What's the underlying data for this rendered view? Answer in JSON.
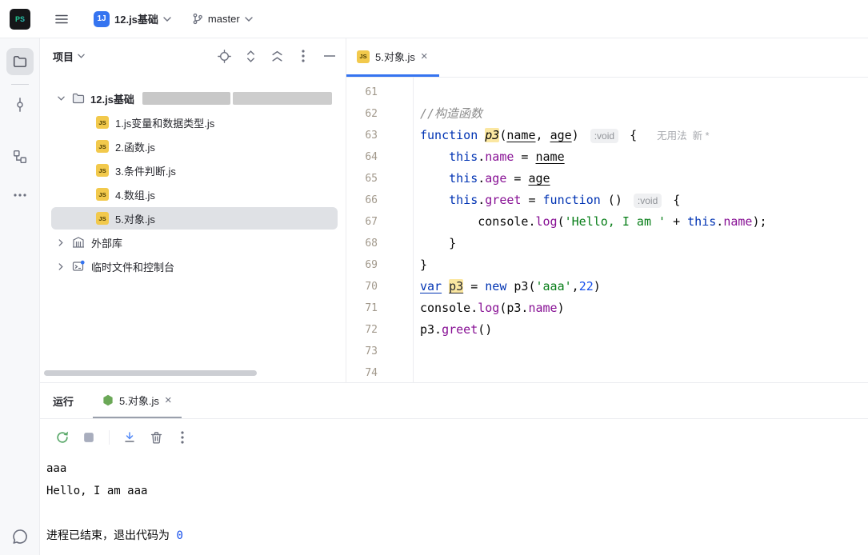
{
  "titlebar": {
    "app_initials": "PS",
    "project_badge": "1J",
    "project_name": "12.js基础",
    "branch_name": "master"
  },
  "project_panel": {
    "title": "项目",
    "root_label": "12.js基础",
    "files": [
      {
        "label": "1.js变量和数据类型.js"
      },
      {
        "label": "2.函数.js"
      },
      {
        "label": "3.条件判断.js"
      },
      {
        "label": "4.数组.js"
      },
      {
        "label": "5.对象.js"
      }
    ],
    "nodes": [
      {
        "label": "外部库"
      },
      {
        "label": "临时文件和控制台"
      }
    ]
  },
  "editor": {
    "tab_label": "5.对象.js",
    "lines": [
      {
        "num": 61,
        "tokens": []
      },
      {
        "num": 62,
        "tokens": [
          {
            "t": "//构造函数",
            "c": "cmt"
          }
        ]
      },
      {
        "num": 63,
        "tokens": [
          {
            "t": "function ",
            "c": "kw"
          },
          {
            "t": "p3",
            "c": "fn hl"
          },
          {
            "t": "(",
            "c": "plain"
          },
          {
            "t": "name",
            "c": "param"
          },
          {
            "t": ", ",
            "c": "plain"
          },
          {
            "t": "age",
            "c": "param"
          },
          {
            "t": ") ",
            "c": "plain"
          },
          {
            "t": ":void",
            "c": "hint"
          },
          {
            "t": " { ",
            "c": "plain"
          },
          {
            "t": "无用法  新 *",
            "c": "usage"
          }
        ]
      },
      {
        "num": 64,
        "tokens": [
          {
            "t": "    ",
            "c": "plain"
          },
          {
            "t": "this",
            "c": "kw"
          },
          {
            "t": ".",
            "c": "plain"
          },
          {
            "t": "name",
            "c": "prop"
          },
          {
            "t": " = ",
            "c": "plain"
          },
          {
            "t": "name",
            "c": "param"
          }
        ]
      },
      {
        "num": 65,
        "tokens": [
          {
            "t": "    ",
            "c": "plain"
          },
          {
            "t": "this",
            "c": "kw"
          },
          {
            "t": ".",
            "c": "plain"
          },
          {
            "t": "age",
            "c": "prop"
          },
          {
            "t": " = ",
            "c": "plain"
          },
          {
            "t": "age",
            "c": "param"
          }
        ]
      },
      {
        "num": 66,
        "tokens": [
          {
            "t": "    ",
            "c": "plain"
          },
          {
            "t": "this",
            "c": "kw"
          },
          {
            "t": ".",
            "c": "plain"
          },
          {
            "t": "greet",
            "c": "prop"
          },
          {
            "t": " = ",
            "c": "plain"
          },
          {
            "t": "function",
            "c": "kw"
          },
          {
            "t": " () ",
            "c": "plain"
          },
          {
            "t": ":void",
            "c": "hint"
          },
          {
            "t": " {",
            "c": "plain"
          }
        ]
      },
      {
        "num": 67,
        "tokens": [
          {
            "t": "        console.",
            "c": "plain"
          },
          {
            "t": "log",
            "c": "prop"
          },
          {
            "t": "(",
            "c": "plain"
          },
          {
            "t": "'Hello, I am '",
            "c": "str"
          },
          {
            "t": " + ",
            "c": "plain"
          },
          {
            "t": "this",
            "c": "kw"
          },
          {
            "t": ".",
            "c": "plain"
          },
          {
            "t": "name",
            "c": "prop"
          },
          {
            "t": ");",
            "c": "plain"
          }
        ]
      },
      {
        "num": 68,
        "tokens": [
          {
            "t": "    }",
            "c": "plain"
          }
        ]
      },
      {
        "num": 69,
        "tokens": [
          {
            "t": "}",
            "c": "plain"
          }
        ]
      },
      {
        "num": 70,
        "tokens": [
          {
            "t": "var",
            "c": "kw under"
          },
          {
            "t": " ",
            "c": "plain"
          },
          {
            "t": "p3",
            "c": "hl under"
          },
          {
            "t": " = ",
            "c": "plain"
          },
          {
            "t": "new",
            "c": "kw"
          },
          {
            "t": " p3(",
            "c": "plain"
          },
          {
            "t": "'aaa'",
            "c": "str"
          },
          {
            "t": ",",
            "c": "plain"
          },
          {
            "t": "22",
            "c": "num"
          },
          {
            "t": ")",
            "c": "plain"
          }
        ]
      },
      {
        "num": 71,
        "tokens": [
          {
            "t": "console.",
            "c": "plain"
          },
          {
            "t": "log",
            "c": "prop"
          },
          {
            "t": "(p3.",
            "c": "plain"
          },
          {
            "t": "name",
            "c": "prop"
          },
          {
            "t": ")",
            "c": "plain"
          }
        ]
      },
      {
        "num": 72,
        "tokens": [
          {
            "t": "p3.",
            "c": "plain"
          },
          {
            "t": "greet",
            "c": "prop"
          },
          {
            "t": "()",
            "c": "plain"
          }
        ]
      },
      {
        "num": 73,
        "tokens": []
      },
      {
        "num": 74,
        "tokens": []
      }
    ]
  },
  "run_panel": {
    "title": "运行",
    "tab_label": "5.对象.js",
    "output_lines": [
      "aaa",
      "Hello, I am aaa",
      ""
    ],
    "exit_prefix": "进程已结束，退出代码为 ",
    "exit_code": "0"
  }
}
